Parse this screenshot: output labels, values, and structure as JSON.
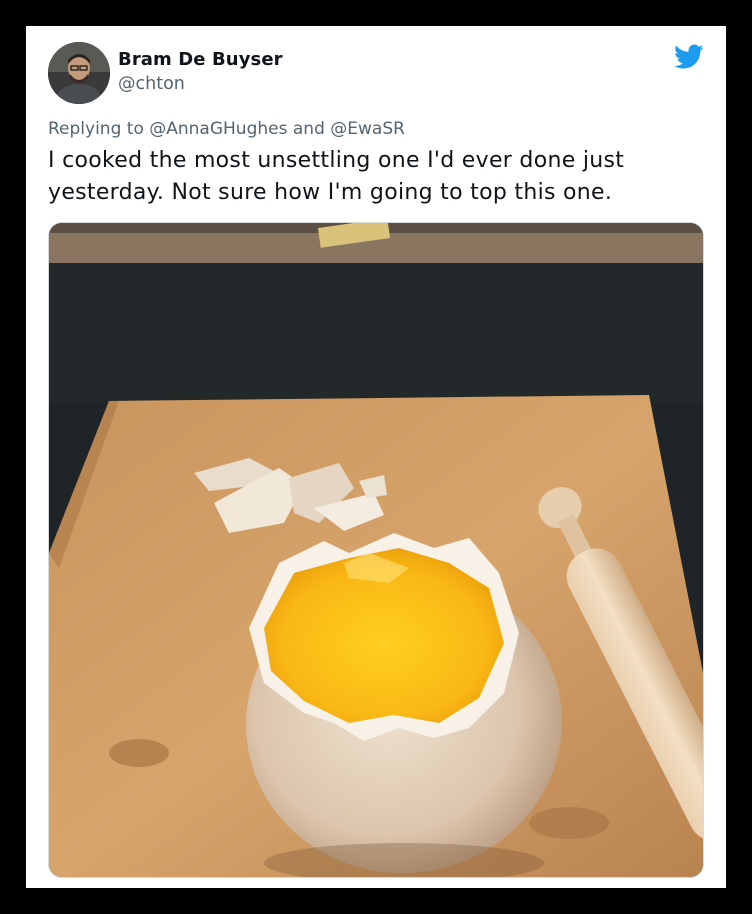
{
  "tweet": {
    "author": {
      "display_name": "Bram De Buyser",
      "handle": "@chton",
      "avatar_icon": "user-avatar-photo"
    },
    "platform_icon": "twitter-bird-icon",
    "reply": {
      "prefix": "Replying to",
      "mention_1": "@AnnaGHughes",
      "joiner": "and",
      "mention_2": "@EwaSR"
    },
    "text": "I cooked the most unsettling one I'd ever done just yesterday. Not sure how I'm going to top this one.",
    "media": {
      "kind": "photo",
      "subject": "egg-on-cutting-board-photo"
    }
  },
  "colors": {
    "background": "#000000",
    "card": "#ffffff",
    "text": "#0f1419",
    "secondary": "#536471",
    "twitter_blue": "#1d9bf0"
  }
}
